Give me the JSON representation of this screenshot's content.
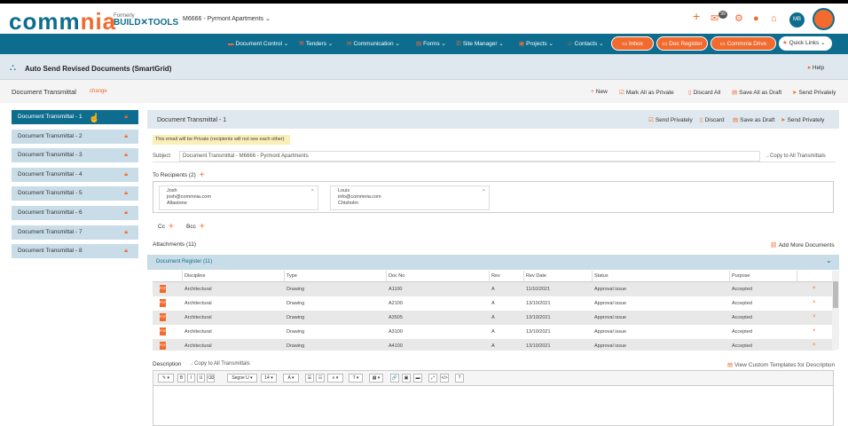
{
  "header": {
    "logo_prefix": "comm",
    "logo_suffix": "nia",
    "formerly": "Formerly",
    "build_tools": "BUILD✕TOOLS",
    "project": "M6666 - Pyrmont Apartments",
    "mail_count": "99",
    "user_initials": "MB"
  },
  "nav": {
    "items": [
      "Document Control",
      "Tenders",
      "Communication",
      "Forms",
      "Site Manager",
      "Projects",
      "Contacts"
    ],
    "buttons": [
      "Inbox",
      "Doc Register",
      "Commnia Drive"
    ],
    "quick_links": "Quick Links"
  },
  "page": {
    "title": "Auto Send Revised Documents (SmartGrid)",
    "help": "Help",
    "dt_label": "Document Transmittal",
    "change": "change",
    "actions": [
      "New",
      "Mark All as Private",
      "Discard All",
      "Save All as Draft",
      "Send Privately"
    ]
  },
  "sidebar": {
    "items": [
      {
        "label": "Document Transmittal - 1"
      },
      {
        "label": "Document Transmittal - 2"
      },
      {
        "label": "Document Transmittal - 3"
      },
      {
        "label": "Document Transmittal - 4"
      },
      {
        "label": "Document Transmittal - 5"
      },
      {
        "label": "Document Transmittal - 6"
      },
      {
        "label": "Document Transmittal - 7"
      },
      {
        "label": "Document Transmittal - 8"
      }
    ]
  },
  "main": {
    "title": "Document Transmittal - 1",
    "actions": [
      "Send Privately",
      "Discard",
      "Save as Draft",
      "Send Privately"
    ],
    "private_note": "This email will be Private (recipients will not see each other)",
    "subject_label": "Subject",
    "subject_value": "Document Transmittal - M6666 - Pyrmont Apartments",
    "copy_all": "Copy to All Transmittals",
    "to_label": "To Recipients (2)",
    "recipients": [
      {
        "name": "Josh",
        "email": "josh@commnia.com",
        "company": "Allastone"
      },
      {
        "name": "Louis",
        "email": "info@commnia.com",
        "company": "Chisholm"
      }
    ],
    "cc_label": "Cc",
    "bcc_label": "Bcc",
    "attachments_label": "Attachments (11)",
    "add_more": "Add More Documents",
    "register_title": "Document Register (11)",
    "columns": [
      "Discipline",
      "Type",
      "Doc No",
      "Rev",
      "Rev Date",
      "Status",
      "Purpose"
    ],
    "rows": [
      [
        "Architectural",
        "Drawing",
        "A1100",
        "A",
        "11/10/2021",
        "Approval issue",
        "Accepted"
      ],
      [
        "Architectural",
        "Drawing",
        "A2100",
        "A",
        "13/10/2021",
        "Approval issue",
        "Accepted"
      ],
      [
        "Architectural",
        "Drawing",
        "A3505",
        "A",
        "13/10/2021",
        "Approval issue",
        "Accepted"
      ],
      [
        "Architectural",
        "Drawing",
        "A3100",
        "A",
        "13/10/2021",
        "Approval issue",
        "Accepted"
      ],
      [
        "Architectural",
        "Drawing",
        "A4100",
        "A",
        "13/10/2021",
        "Approval issue",
        "Accepted"
      ]
    ],
    "description_label": "Description",
    "desc_copy": "Copy to All Transmittals",
    "desc_templates": "View Custom Templates for Description",
    "toolbar": [
      "✎ ▾",
      "B",
      "I",
      "U",
      "⌫",
      "Segoe U ▾",
      "14 ▾",
      "A ▾",
      "☰",
      "☷",
      "≡ ▾",
      "T ▾",
      "▦ ▾",
      "🔗",
      "▣",
      "▬",
      "⤢",
      "</>",
      "?"
    ]
  },
  "colors": {
    "brand": "#0e6d8e",
    "accent": "#f26a2e"
  },
  "icons": [
    "plus-icon",
    "mail-icon",
    "gear-icon",
    "alert-icon",
    "home-icon",
    "lock-icon",
    "pdf-icon",
    "chevron-down-icon",
    "help-icon",
    "close-icon"
  ]
}
